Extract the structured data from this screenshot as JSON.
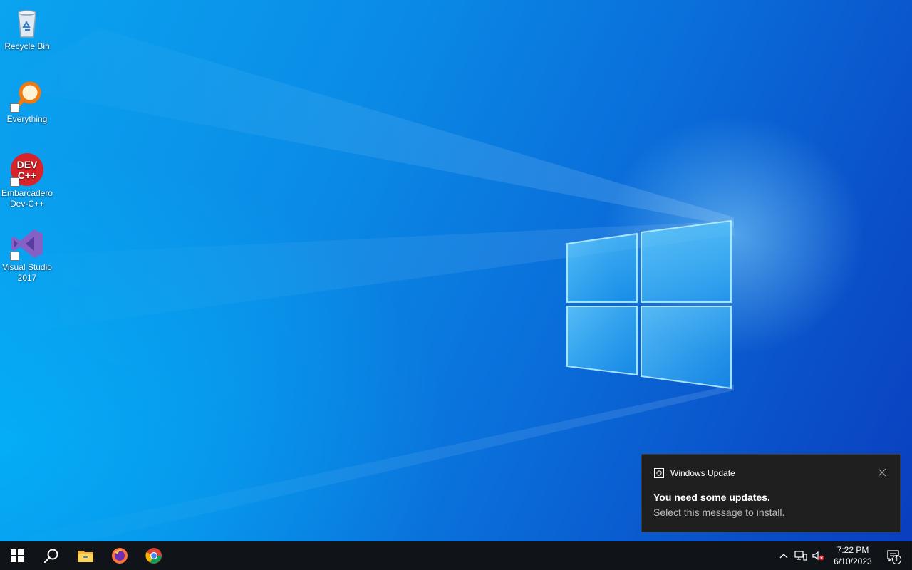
{
  "desktop": {
    "icons": [
      {
        "label": "Recycle Bin",
        "icon": "recycle-bin-icon"
      },
      {
        "label": "Everything",
        "icon": "everything-search-icon"
      },
      {
        "label": "Embarcadero Dev-C++",
        "icon": "devcpp-icon",
        "icon_text": "DEV C++"
      },
      {
        "label": "Visual Studio 2017",
        "icon": "visual-studio-icon"
      }
    ]
  },
  "notification": {
    "app_name": "Windows Update",
    "title": "You need some updates.",
    "body": "Select this message to install."
  },
  "taskbar": {
    "pinned": [
      "start-icon",
      "search-icon",
      "file-explorer-icon",
      "firefox-icon",
      "chrome-icon"
    ],
    "clock": {
      "time": "7:22 PM",
      "date": "6/10/2023"
    },
    "notification_count": "1"
  },
  "colors": {
    "taskbar": "#101418",
    "toast": "#1f1f1f",
    "wallpaper_accent": "#0a7ad8"
  }
}
